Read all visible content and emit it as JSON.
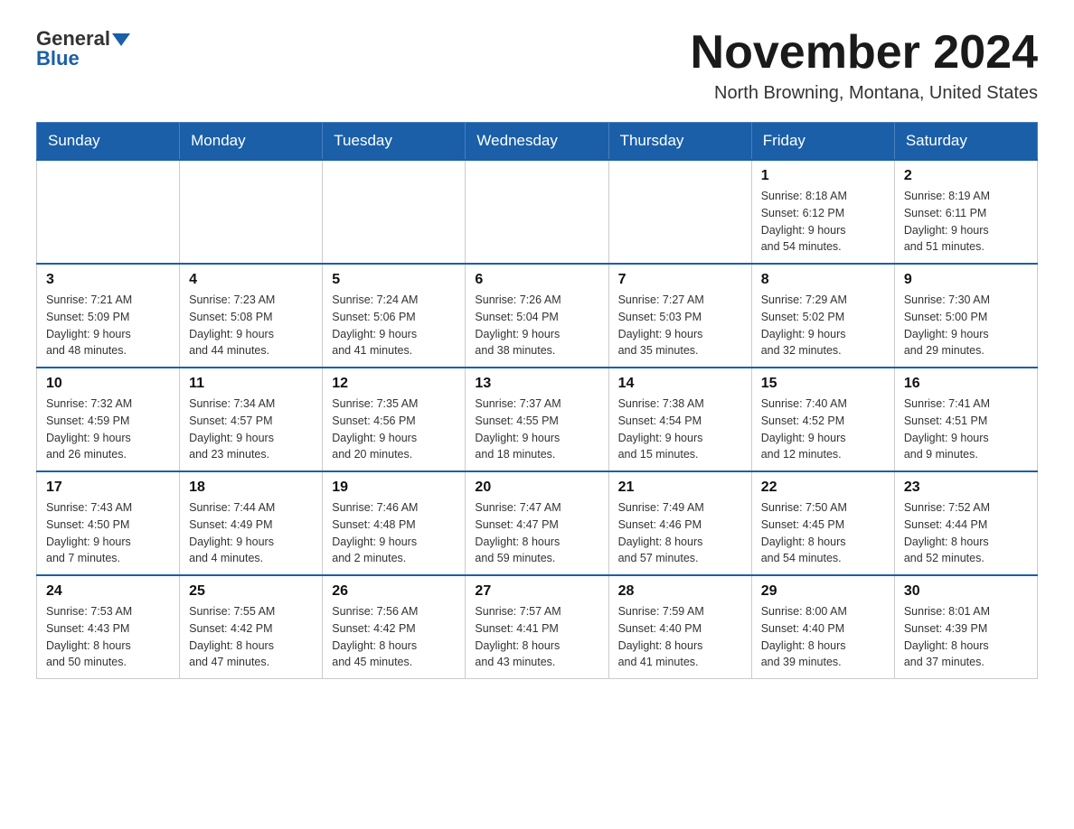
{
  "logo": {
    "part1": "General",
    "part2": "Blue"
  },
  "title": {
    "month_year": "November 2024",
    "location": "North Browning, Montana, United States"
  },
  "weekdays": [
    "Sunday",
    "Monday",
    "Tuesday",
    "Wednesday",
    "Thursday",
    "Friday",
    "Saturday"
  ],
  "weeks": [
    [
      {
        "day": "",
        "info": ""
      },
      {
        "day": "",
        "info": ""
      },
      {
        "day": "",
        "info": ""
      },
      {
        "day": "",
        "info": ""
      },
      {
        "day": "",
        "info": ""
      },
      {
        "day": "1",
        "info": "Sunrise: 8:18 AM\nSunset: 6:12 PM\nDaylight: 9 hours\nand 54 minutes."
      },
      {
        "day": "2",
        "info": "Sunrise: 8:19 AM\nSunset: 6:11 PM\nDaylight: 9 hours\nand 51 minutes."
      }
    ],
    [
      {
        "day": "3",
        "info": "Sunrise: 7:21 AM\nSunset: 5:09 PM\nDaylight: 9 hours\nand 48 minutes."
      },
      {
        "day": "4",
        "info": "Sunrise: 7:23 AM\nSunset: 5:08 PM\nDaylight: 9 hours\nand 44 minutes."
      },
      {
        "day": "5",
        "info": "Sunrise: 7:24 AM\nSunset: 5:06 PM\nDaylight: 9 hours\nand 41 minutes."
      },
      {
        "day": "6",
        "info": "Sunrise: 7:26 AM\nSunset: 5:04 PM\nDaylight: 9 hours\nand 38 minutes."
      },
      {
        "day": "7",
        "info": "Sunrise: 7:27 AM\nSunset: 5:03 PM\nDaylight: 9 hours\nand 35 minutes."
      },
      {
        "day": "8",
        "info": "Sunrise: 7:29 AM\nSunset: 5:02 PM\nDaylight: 9 hours\nand 32 minutes."
      },
      {
        "day": "9",
        "info": "Sunrise: 7:30 AM\nSunset: 5:00 PM\nDaylight: 9 hours\nand 29 minutes."
      }
    ],
    [
      {
        "day": "10",
        "info": "Sunrise: 7:32 AM\nSunset: 4:59 PM\nDaylight: 9 hours\nand 26 minutes."
      },
      {
        "day": "11",
        "info": "Sunrise: 7:34 AM\nSunset: 4:57 PM\nDaylight: 9 hours\nand 23 minutes."
      },
      {
        "day": "12",
        "info": "Sunrise: 7:35 AM\nSunset: 4:56 PM\nDaylight: 9 hours\nand 20 minutes."
      },
      {
        "day": "13",
        "info": "Sunrise: 7:37 AM\nSunset: 4:55 PM\nDaylight: 9 hours\nand 18 minutes."
      },
      {
        "day": "14",
        "info": "Sunrise: 7:38 AM\nSunset: 4:54 PM\nDaylight: 9 hours\nand 15 minutes."
      },
      {
        "day": "15",
        "info": "Sunrise: 7:40 AM\nSunset: 4:52 PM\nDaylight: 9 hours\nand 12 minutes."
      },
      {
        "day": "16",
        "info": "Sunrise: 7:41 AM\nSunset: 4:51 PM\nDaylight: 9 hours\nand 9 minutes."
      }
    ],
    [
      {
        "day": "17",
        "info": "Sunrise: 7:43 AM\nSunset: 4:50 PM\nDaylight: 9 hours\nand 7 minutes."
      },
      {
        "day": "18",
        "info": "Sunrise: 7:44 AM\nSunset: 4:49 PM\nDaylight: 9 hours\nand 4 minutes."
      },
      {
        "day": "19",
        "info": "Sunrise: 7:46 AM\nSunset: 4:48 PM\nDaylight: 9 hours\nand 2 minutes."
      },
      {
        "day": "20",
        "info": "Sunrise: 7:47 AM\nSunset: 4:47 PM\nDaylight: 8 hours\nand 59 minutes."
      },
      {
        "day": "21",
        "info": "Sunrise: 7:49 AM\nSunset: 4:46 PM\nDaylight: 8 hours\nand 57 minutes."
      },
      {
        "day": "22",
        "info": "Sunrise: 7:50 AM\nSunset: 4:45 PM\nDaylight: 8 hours\nand 54 minutes."
      },
      {
        "day": "23",
        "info": "Sunrise: 7:52 AM\nSunset: 4:44 PM\nDaylight: 8 hours\nand 52 minutes."
      }
    ],
    [
      {
        "day": "24",
        "info": "Sunrise: 7:53 AM\nSunset: 4:43 PM\nDaylight: 8 hours\nand 50 minutes."
      },
      {
        "day": "25",
        "info": "Sunrise: 7:55 AM\nSunset: 4:42 PM\nDaylight: 8 hours\nand 47 minutes."
      },
      {
        "day": "26",
        "info": "Sunrise: 7:56 AM\nSunset: 4:42 PM\nDaylight: 8 hours\nand 45 minutes."
      },
      {
        "day": "27",
        "info": "Sunrise: 7:57 AM\nSunset: 4:41 PM\nDaylight: 8 hours\nand 43 minutes."
      },
      {
        "day": "28",
        "info": "Sunrise: 7:59 AM\nSunset: 4:40 PM\nDaylight: 8 hours\nand 41 minutes."
      },
      {
        "day": "29",
        "info": "Sunrise: 8:00 AM\nSunset: 4:40 PM\nDaylight: 8 hours\nand 39 minutes."
      },
      {
        "day": "30",
        "info": "Sunrise: 8:01 AM\nSunset: 4:39 PM\nDaylight: 8 hours\nand 37 minutes."
      }
    ]
  ]
}
